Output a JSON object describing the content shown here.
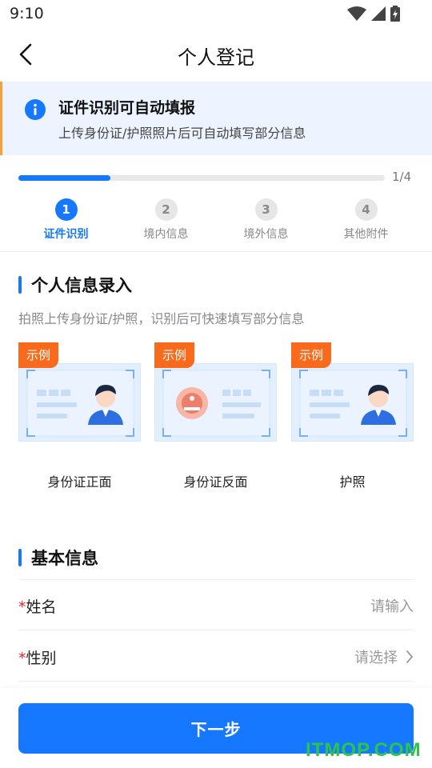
{
  "status_bar": {
    "time": "9:10"
  },
  "nav": {
    "title": "个人登记"
  },
  "notice": {
    "title": "证件识别可自动填报",
    "subtitle": "上传身份证/护照照片后可自动填写部分信息"
  },
  "progress": {
    "fraction": 0.25,
    "text": "1/4"
  },
  "steps": [
    {
      "number": "1",
      "label": "证件识别",
      "active": true
    },
    {
      "number": "2",
      "label": "境内信息",
      "active": false
    },
    {
      "number": "3",
      "label": "境外信息",
      "active": false
    },
    {
      "number": "4",
      "label": "其他附件",
      "active": false
    }
  ],
  "personal_section": {
    "title": "个人信息录入",
    "subtitle": "拍照上传身份证/护照，识别后可快速填写部分信息"
  },
  "doc_cards": [
    {
      "tag": "示例",
      "label": "身份证正面",
      "icon": "id-card-front-icon"
    },
    {
      "tag": "示例",
      "label": "身份证反面",
      "icon": "id-card-back-icon"
    },
    {
      "tag": "示例",
      "label": "护照",
      "icon": "passport-icon"
    }
  ],
  "basic_section": {
    "title": "基本信息"
  },
  "form": {
    "name": {
      "label": "姓名",
      "required": "*",
      "placeholder": "请输入"
    },
    "gender": {
      "label": "性别",
      "required": "*",
      "placeholder": "请选择"
    }
  },
  "footer": {
    "next_label": "下一步"
  },
  "watermark": "ITMOP.COM",
  "colors": {
    "accent": "#1677ff",
    "tag": "#fa6a1c",
    "notice_bg": "#eef4ff",
    "required": "#f5222d"
  }
}
